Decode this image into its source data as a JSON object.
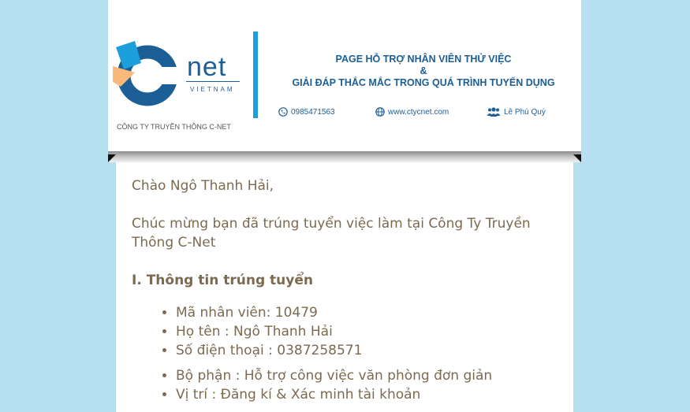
{
  "banner": {
    "logo_text": "net",
    "logo_subtext": "VIETNAM",
    "company": "CÔNG TY TRUYỀN THÔNG C-NET",
    "headline": [
      "PAGE HỖ TRỢ NHÂN VIÊN THỬ VIỆC",
      "&",
      "GIẢI ĐÁP THẮC MẮC TRONG QUÁ TRÌNH TUYỂN DỤNG"
    ],
    "phone": "0985471563",
    "website": "www.ctycnet.com",
    "person": "Lê Phú Quý",
    "colors": {
      "brand_blue": "#1c5e96",
      "accent_blue": "#1ba0dc",
      "accent_orange": "#f8b97a"
    }
  },
  "email": {
    "greeting": "Chào Ngô Thanh Hải,",
    "congrats": "Chúc mừng bạn đã trúng tuyển việc làm tại Công Ty Truyền Thông C-Net",
    "section1_title": "I. Thông tin trúng tuyển",
    "info_group1": [
      "Mã nhân viên: 10479",
      "Họ tên : Ngô Thanh Hải",
      "Số điện thoại : 0387258571"
    ],
    "info_group2": [
      "Bộ phận : Hỗ trợ công việc văn phòng đơn giản",
      "Vị trí : Đăng kí & Xác minh tài khoản"
    ]
  }
}
